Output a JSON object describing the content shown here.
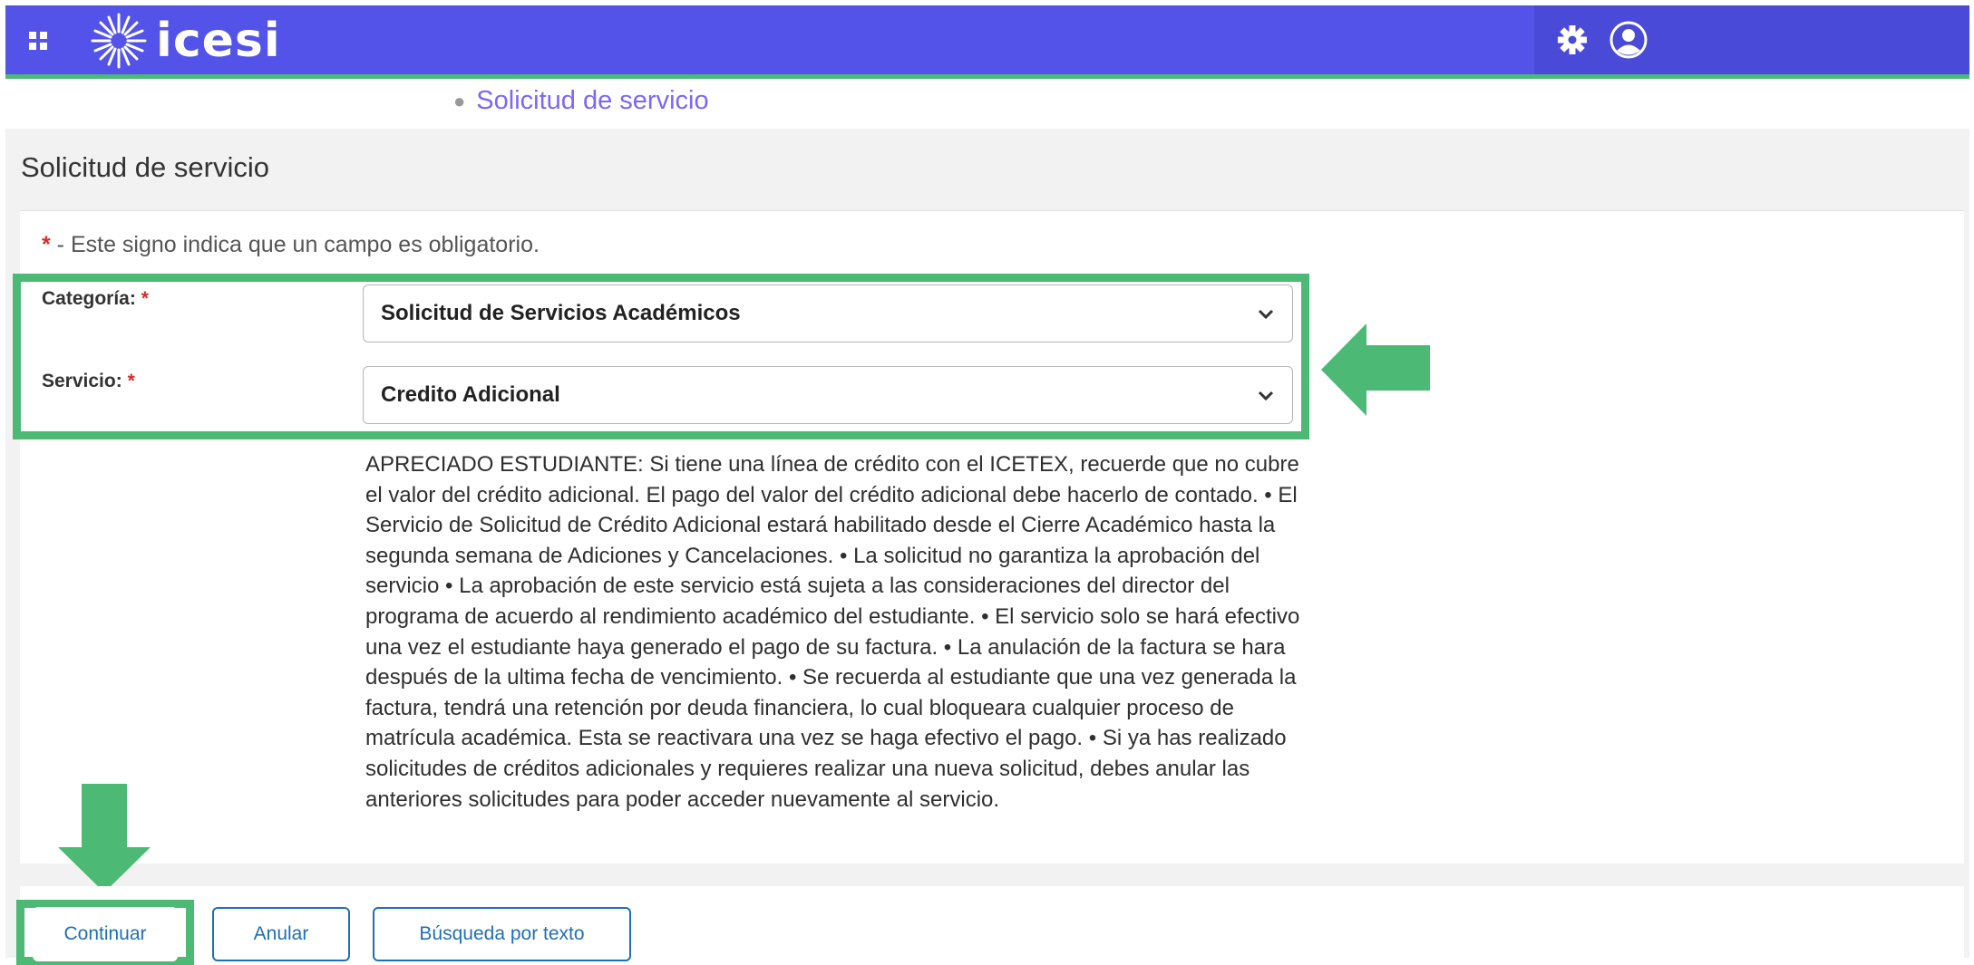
{
  "header": {
    "logo_text": "icesi",
    "icons": [
      "grid-icon",
      "gear-icon",
      "user-icon"
    ]
  },
  "breadcrumb": {
    "current": "Solicitud de servicio"
  },
  "page": {
    "title": "Solicitud de servicio"
  },
  "form": {
    "required_note_star": "*",
    "required_note_text": " - Este signo indica que un campo es obligatorio.",
    "categoria": {
      "label": "Categoría:",
      "star": "*",
      "value": "Solicitud de Servicios Académicos"
    },
    "servicio": {
      "label": "Servicio:",
      "star": "*",
      "value": "Credito Adicional"
    },
    "description": "APRECIADO ESTUDIANTE: Si tiene una línea de crédito con el ICETEX, recuerde que no cubre el valor del crédito adicional. El pago del valor del crédito adicional debe hacerlo de contado. • El Servicio de Solicitud de Crédito Adicional estará habilitado desde el Cierre Académico hasta la segunda semana de Adiciones y Cancelaciones. • La solicitud no garantiza la aprobación del servicio • La aprobación de este servicio está sujeta a las consideraciones del director del programa de acuerdo al rendimiento académico del estudiante. • El servicio solo se hará efectivo una vez el estudiante haya generado el pago de su factura. • La anulación de la factura se hara después de la ultima fecha de vencimiento. • Se recuerda al estudiante que una vez generada la factura, tendrá una retención por deuda financiera, lo cual bloqueara cualquier proceso de matrícula académica. Esta se reactivara una vez se haga efectivo el pago. • Si ya has realizado solicitudes de créditos adicionales y requieres realizar una nueva solicitud, debes anular las anteriores solicitudes para poder acceder nuevamente al servicio."
  },
  "buttons": {
    "continuar": "Continuar",
    "anular": "Anular",
    "busqueda": "Búsqueda por texto"
  },
  "colors": {
    "header": "#5353e9",
    "accent_green": "#4cba74",
    "link_purple": "#7e67f5",
    "button_blue": "#1f6fb5"
  }
}
